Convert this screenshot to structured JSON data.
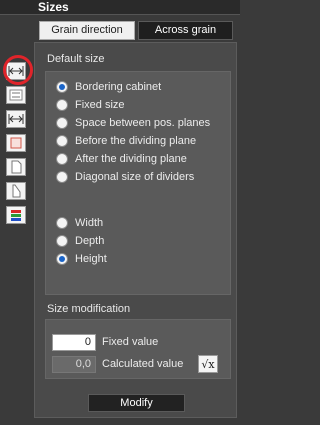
{
  "title": "Sizes",
  "tabs": [
    {
      "label": "Grain direction",
      "active": false
    },
    {
      "label": "Across grain",
      "active": true
    }
  ],
  "toolbar": {
    "icons": [
      "width-arrows-icon",
      "cabinet-front-icon",
      "width-arrows-outline-icon",
      "panel-icon",
      "document-icon",
      "side-panel-icon",
      "colored-layers-icon"
    ],
    "highlight_color": "#e0242a"
  },
  "default_size": {
    "title": "Default size",
    "options": [
      {
        "label": "Bordering cabinet",
        "selected": true
      },
      {
        "label": "Fixed size",
        "selected": false
      },
      {
        "label": "Space between pos. planes",
        "selected": false
      },
      {
        "label": "Before the dividing plane",
        "selected": false
      },
      {
        "label": "After the dividing plane",
        "selected": false
      },
      {
        "label": "Diagonal size of dividers",
        "selected": false
      }
    ],
    "dimensions": [
      {
        "label": "Width",
        "selected": false
      },
      {
        "label": "Depth",
        "selected": false
      },
      {
        "label": "Height",
        "selected": true
      }
    ]
  },
  "size_modification": {
    "title": "Size modification",
    "fixed_value": "0",
    "fixed_label": "Fixed value",
    "calculated_value": "0,0",
    "calculated_label": "Calculated value",
    "sqrt_label": "√x"
  },
  "modify_button": "Modify",
  "colors": {
    "accent": "#1a64c8",
    "background": "#3a3a3a",
    "panel": "#4a4a4a"
  }
}
